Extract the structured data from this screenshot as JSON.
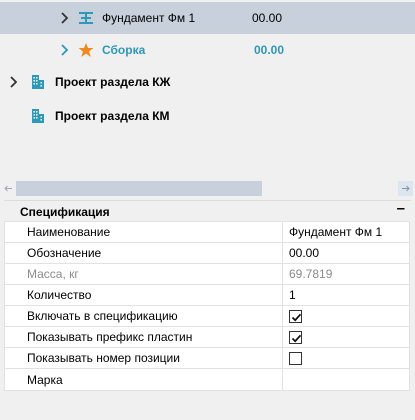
{
  "tree": {
    "items": [
      {
        "label": "Фундамент Фм 1",
        "value": "00.00",
        "icon": "beam-icon",
        "selected": true
      },
      {
        "label": "Сборка",
        "value": "00.00",
        "icon": "star-icon",
        "selected": false
      },
      {
        "label": "Проект раздела КЖ",
        "value": "",
        "icon": "building-icon",
        "selected": false
      },
      {
        "label": "Проект раздела КМ",
        "value": "",
        "icon": "building-icon",
        "selected": false
      }
    ]
  },
  "scrollbar": {
    "left_glyph": "←",
    "right_glyph": "→",
    "position": 0
  },
  "properties": {
    "section_title": "Спецификация",
    "collapse_glyph": "–",
    "rows": [
      {
        "key": "Наименование",
        "value": "Фундамент Фм 1",
        "type": "text",
        "disabled": false
      },
      {
        "key": "Обозначение",
        "value": "00.00",
        "type": "text",
        "disabled": false
      },
      {
        "key": "Масса, кг",
        "value": "69.7819",
        "type": "text",
        "disabled": true
      },
      {
        "key": "Количество",
        "value": "1",
        "type": "text",
        "disabled": false
      },
      {
        "key": "Включать в спецификацию",
        "checked": true,
        "type": "checkbox",
        "disabled": false
      },
      {
        "key": "Показывать префикс пластин",
        "checked": true,
        "type": "checkbox",
        "disabled": false
      },
      {
        "key": "Показывать номер позиции",
        "checked": false,
        "type": "checkbox",
        "disabled": false
      },
      {
        "key": "Марка",
        "value": "",
        "type": "text",
        "disabled": false
      }
    ]
  },
  "colors": {
    "accent_teal": "#2e98b9",
    "star_orange": "#f08a1f",
    "selection": "#c8d0db",
    "panel_bg": "#f0f0f0"
  }
}
